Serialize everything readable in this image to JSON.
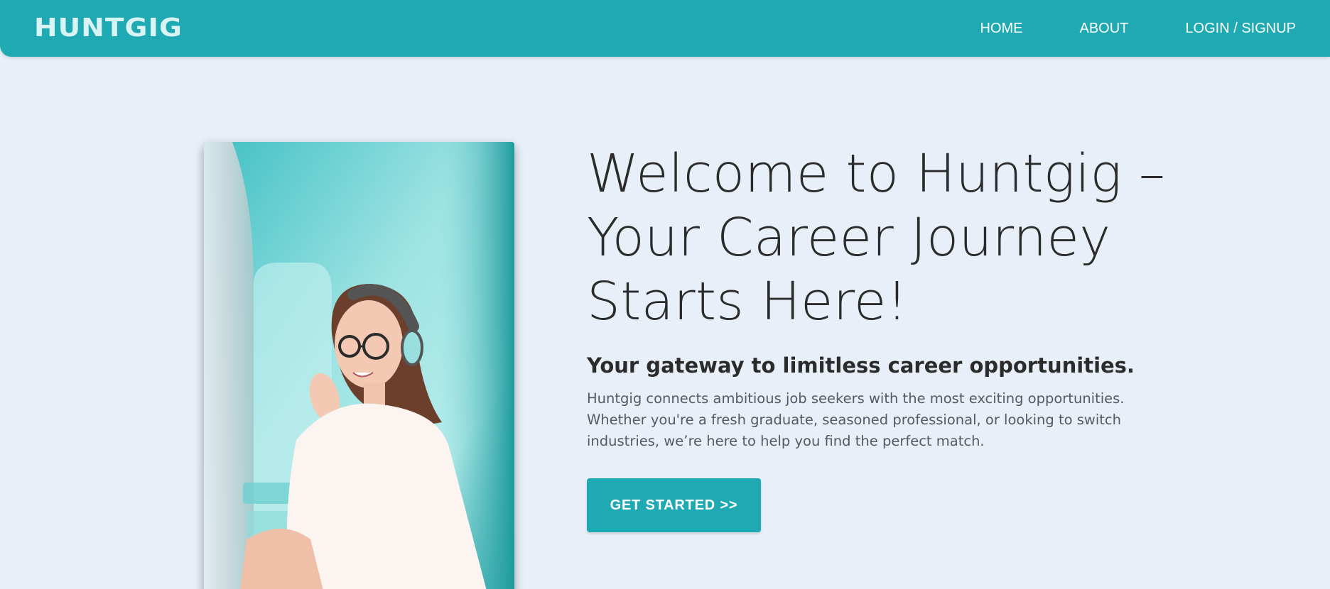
{
  "header": {
    "logo_text": "HUNTGIG",
    "nav": [
      {
        "label": "HOME"
      },
      {
        "label": "ABOUT"
      },
      {
        "label": "LOGIN / SIGNUP"
      }
    ]
  },
  "hero": {
    "title": "Welcome to Huntgig – Your Career Journey Starts Here!",
    "subtitle": "Your gateway to limitless career opportunities.",
    "description": "Huntgig connects ambitious job seekers with the most exciting opportunities. Whether you're a fresh graduate, seasoned professional, or looking to switch industries, we’re here to help you find the perfect match.",
    "cta_label": "GET STARTED >>"
  },
  "colors": {
    "brand": "#1fa9b3",
    "background": "#e8eff8",
    "text": "#2b2b2b"
  }
}
